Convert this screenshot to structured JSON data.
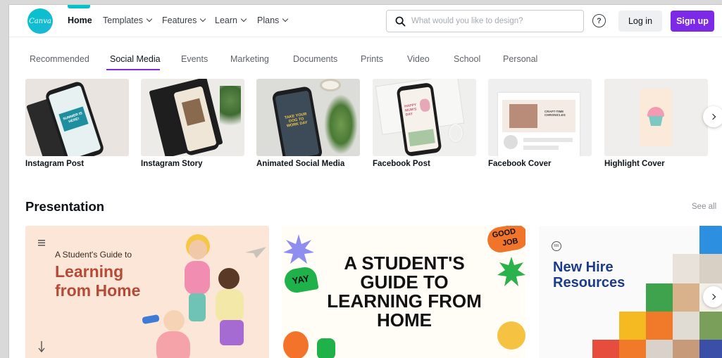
{
  "header": {
    "logo_text": "Canva",
    "nav": [
      {
        "label": "Home"
      },
      {
        "label": "Templates"
      },
      {
        "label": "Features"
      },
      {
        "label": "Learn"
      },
      {
        "label": "Plans"
      }
    ],
    "search_placeholder": "What would you like to design?",
    "help_symbol": "?",
    "login_label": "Log in",
    "signup_label": "Sign up"
  },
  "categories": [
    {
      "label": "Recommended"
    },
    {
      "label": "Social Media"
    },
    {
      "label": "Events"
    },
    {
      "label": "Marketing"
    },
    {
      "label": "Documents"
    },
    {
      "label": "Prints"
    },
    {
      "label": "Video"
    },
    {
      "label": "School"
    },
    {
      "label": "Personal"
    }
  ],
  "templates": [
    {
      "label": "Instagram Post",
      "screen_text": "SUMMER IS HERE!"
    },
    {
      "label": "Instagram Story"
    },
    {
      "label": "Animated Social Media",
      "screen_text": "TAKE YOUR DOG TO WORK DAY"
    },
    {
      "label": "Facebook Post",
      "screen_text": "HAPPY MUM'S DAY"
    },
    {
      "label": "Facebook Cover",
      "screen_text": "CRAFT-TIME CHRONICLES"
    },
    {
      "label": "Highlight Cover"
    }
  ],
  "presentation": {
    "title": "Presentation",
    "see_all": "See all",
    "cards": [
      {
        "line1": "A Student's Guide to",
        "line2": "Learning",
        "line3": "from Home"
      },
      {
        "headline": "A STUDENT'S GUIDE TO LEARNING FROM HOME",
        "sticker_yay": "YAY",
        "sticker_good": "GOOD",
        "sticker_job": "JOB"
      },
      {
        "line1": "New Hire",
        "line2": "Resources",
        "badge": "RR"
      }
    ]
  },
  "colors": {
    "brand_teal": "#00c4cc",
    "brand_purple": "#7d2ae8",
    "text_dark": "#0e1318"
  },
  "icons": [
    "search-icon",
    "help-icon",
    "chevron-down-icon",
    "chevron-right-icon",
    "hamburger-icon",
    "arrow-down-icon"
  ]
}
